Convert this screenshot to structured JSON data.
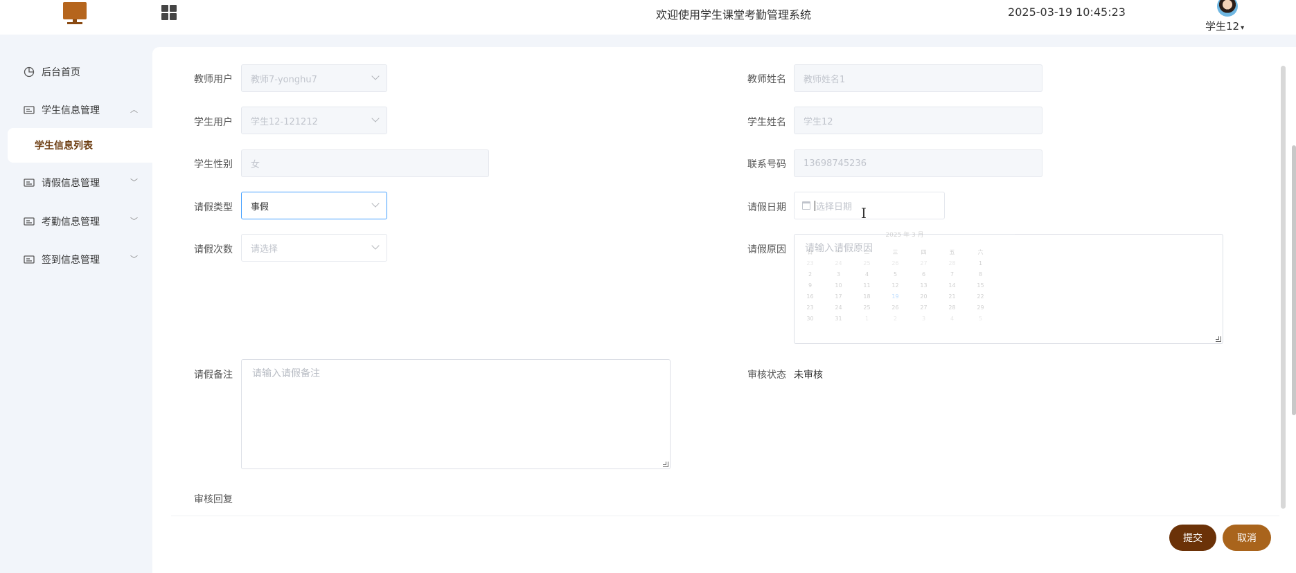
{
  "header": {
    "title": "欢迎使用学生课堂考勤管理系统",
    "datetime": "2025-03-19 10:45:23",
    "user": "学生12",
    "icons": {
      "logo": "monitor-icon",
      "apps": "grid-icon",
      "caret": "chevron-down-icon"
    }
  },
  "sidebar": {
    "items": [
      {
        "label": "后台首页",
        "icon": "pie-chart-icon"
      },
      {
        "label": "学生信息管理",
        "icon": "id-card-icon",
        "expanded": true
      },
      {
        "label": "请假信息管理",
        "icon": "id-card-icon"
      },
      {
        "label": "考勤信息管理",
        "icon": "id-card-icon"
      },
      {
        "label": "签到信息管理",
        "icon": "id-card-icon"
      }
    ],
    "sub_item": "学生信息列表"
  },
  "form": {
    "teacher_user": {
      "label": "教师用户",
      "value": "教师7-yonghu7"
    },
    "teacher_name": {
      "label": "教师姓名",
      "value": "教师姓名1"
    },
    "student_user": {
      "label": "学生用户",
      "value": "学生12-121212"
    },
    "student_name": {
      "label": "学生姓名",
      "value": "学生12"
    },
    "gender": {
      "label": "学生性别",
      "value": "女"
    },
    "phone": {
      "label": "联系号码",
      "value": "13698745236"
    },
    "leave_type": {
      "label": "请假类型",
      "value": "事假"
    },
    "leave_date": {
      "label": "请假日期",
      "placeholder": "选择日期"
    },
    "leave_count": {
      "label": "请假次数",
      "placeholder": "请选择"
    },
    "leave_reason": {
      "label": "请假原因",
      "placeholder": "请输入请假原因"
    },
    "leave_note": {
      "label": "请假备注",
      "placeholder": "请输入请假备注"
    },
    "review_status": {
      "label": "审核状态",
      "value": "未审核"
    },
    "review_reply": {
      "label": "审核回复"
    }
  },
  "datepicker": {
    "header": "2025 年 3 月",
    "weekdays": [
      "日",
      "一",
      "二",
      "三",
      "四",
      "五",
      "六"
    ],
    "weeks": [
      [
        "23",
        "24",
        "25",
        "26",
        "27",
        "28",
        "1"
      ],
      [
        "2",
        "3",
        "4",
        "5",
        "6",
        "7",
        "8"
      ],
      [
        "9",
        "10",
        "11",
        "12",
        "13",
        "14",
        "15"
      ],
      [
        "16",
        "17",
        "18",
        "19",
        "20",
        "21",
        "22"
      ],
      [
        "23",
        "24",
        "25",
        "26",
        "27",
        "28",
        "29"
      ],
      [
        "30",
        "31",
        "1",
        "2",
        "3",
        "4",
        "5"
      ]
    ],
    "today": "19"
  },
  "buttons": {
    "submit": "提交",
    "cancel": "取消"
  }
}
